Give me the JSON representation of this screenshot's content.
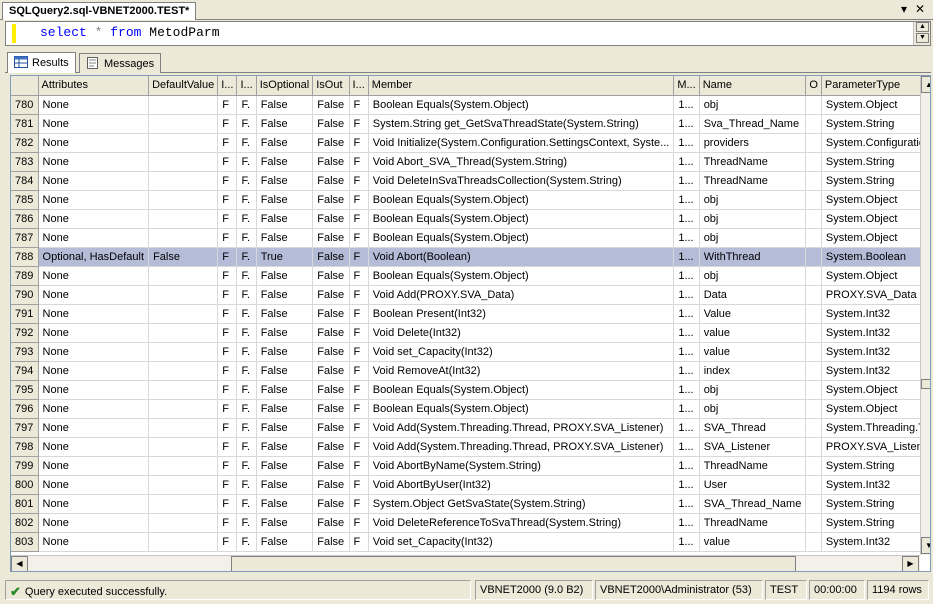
{
  "document_tab": {
    "title": "SQLQuery2.sql-VBNET2000.TEST*"
  },
  "window_buttons": {
    "pin": "▾",
    "close": "✕"
  },
  "editor": {
    "kw_select": "select",
    "op_star": "*",
    "kw_from": "from",
    "table": "MetodParm"
  },
  "result_tabs": [
    {
      "label": "Results"
    },
    {
      "label": "Messages"
    }
  ],
  "grid": {
    "columns": [
      "Attributes",
      "DefaultValue",
      "I...",
      "I...",
      "IsOptional",
      "IsOut",
      "I...",
      "Member",
      "M...",
      "Name",
      "O",
      "ParameterType"
    ],
    "rows": [
      [
        "780",
        "None",
        "",
        "F",
        "F.",
        "False",
        "False",
        "F",
        "Boolean Equals(System.Object)",
        "1...",
        "obj",
        "",
        "System.Object"
      ],
      [
        "781",
        "None",
        "",
        "F",
        "F.",
        "False",
        "False",
        "F",
        "System.String get_GetSvaThreadState(System.String)",
        "1...",
        "Sva_Thread_Name",
        "",
        "System.String"
      ],
      [
        "782",
        "None",
        "",
        "F",
        "F.",
        "False",
        "False",
        "F",
        "Void Initialize(System.Configuration.SettingsContext, Syste...",
        "1...",
        "providers",
        "",
        "System.Configuratio"
      ],
      [
        "783",
        "None",
        "",
        "F",
        "F.",
        "False",
        "False",
        "F",
        "Void Abort_SVA_Thread(System.String)",
        "1...",
        "ThreadName",
        "",
        "System.String"
      ],
      [
        "784",
        "None",
        "",
        "F",
        "F.",
        "False",
        "False",
        "F",
        "Void DeleteInSvaThreadsCollection(System.String)",
        "1...",
        "ThreadName",
        "",
        "System.String"
      ],
      [
        "785",
        "None",
        "",
        "F",
        "F.",
        "False",
        "False",
        "F",
        "Boolean Equals(System.Object)",
        "1...",
        "obj",
        "",
        "System.Object"
      ],
      [
        "786",
        "None",
        "",
        "F",
        "F.",
        "False",
        "False",
        "F",
        "Boolean Equals(System.Object)",
        "1...",
        "obj",
        "",
        "System.Object"
      ],
      [
        "787",
        "None",
        "",
        "F",
        "F.",
        "False",
        "False",
        "F",
        "Boolean Equals(System.Object)",
        "1...",
        "obj",
        "",
        "System.Object"
      ],
      [
        "788",
        "Optional, HasDefault",
        "False",
        "F",
        "F.",
        "True",
        "False",
        "F",
        "Void Abort(Boolean)",
        "1...",
        "WithThread",
        "",
        "System.Boolean"
      ],
      [
        "789",
        "None",
        "",
        "F",
        "F.",
        "False",
        "False",
        "F",
        "Boolean Equals(System.Object)",
        "1...",
        "obj",
        "",
        "System.Object"
      ],
      [
        "790",
        "None",
        "",
        "F",
        "F.",
        "False",
        "False",
        "F",
        "Void Add(PROXY.SVA_Data)",
        "1...",
        "Data",
        "",
        "PROXY.SVA_Data"
      ],
      [
        "791",
        "None",
        "",
        "F",
        "F.",
        "False",
        "False",
        "F",
        "Boolean Present(Int32)",
        "1...",
        "Value",
        "",
        "System.Int32"
      ],
      [
        "792",
        "None",
        "",
        "F",
        "F.",
        "False",
        "False",
        "F",
        "Void Delete(Int32)",
        "1...",
        "value",
        "",
        "System.Int32"
      ],
      [
        "793",
        "None",
        "",
        "F",
        "F.",
        "False",
        "False",
        "F",
        "Void set_Capacity(Int32)",
        "1...",
        "value",
        "",
        "System.Int32"
      ],
      [
        "794",
        "None",
        "",
        "F",
        "F.",
        "False",
        "False",
        "F",
        "Void RemoveAt(Int32)",
        "1...",
        "index",
        "",
        "System.Int32"
      ],
      [
        "795",
        "None",
        "",
        "F",
        "F.",
        "False",
        "False",
        "F",
        "Boolean Equals(System.Object)",
        "1...",
        "obj",
        "",
        "System.Object"
      ],
      [
        "796",
        "None",
        "",
        "F",
        "F.",
        "False",
        "False",
        "F",
        "Boolean Equals(System.Object)",
        "1...",
        "obj",
        "",
        "System.Object"
      ],
      [
        "797",
        "None",
        "",
        "F",
        "F.",
        "False",
        "False",
        "F",
        "Void Add(System.Threading.Thread, PROXY.SVA_Listener)",
        "1...",
        "SVA_Thread",
        "",
        "System.Threading.T"
      ],
      [
        "798",
        "None",
        "",
        "F",
        "F.",
        "False",
        "False",
        "F",
        "Void Add(System.Threading.Thread, PROXY.SVA_Listener)",
        "1...",
        "SVA_Listener",
        "",
        "PROXY.SVA_Listen"
      ],
      [
        "799",
        "None",
        "",
        "F",
        "F.",
        "False",
        "False",
        "F",
        "Void AbortByName(System.String)",
        "1...",
        "ThreadName",
        "",
        "System.String"
      ],
      [
        "800",
        "None",
        "",
        "F",
        "F.",
        "False",
        "False",
        "F",
        "Void AbortByUser(Int32)",
        "1...",
        "User",
        "",
        "System.Int32"
      ],
      [
        "801",
        "None",
        "",
        "F",
        "F.",
        "False",
        "False",
        "F",
        "System.Object GetSvaState(System.String)",
        "1...",
        "SVA_Thread_Name",
        "",
        "System.String"
      ],
      [
        "802",
        "None",
        "",
        "F",
        "F.",
        "False",
        "False",
        "F",
        "Void DeleteReferenceToSvaThread(System.String)",
        "1...",
        "ThreadName",
        "",
        "System.String"
      ],
      [
        "803",
        "None",
        "",
        "F",
        "F.",
        "False",
        "False",
        "F",
        "Void set_Capacity(Int32)",
        "1...",
        "value",
        "",
        "System.Int32"
      ]
    ],
    "selected_row": "788"
  },
  "status": {
    "message": "Query executed successfully.",
    "server": "VBNET2000 (9.0 B2)",
    "user": "VBNET2000\\Administrator (53)",
    "database": "TEST",
    "elapsed": "00:00:00",
    "rows": "1194 rows"
  }
}
